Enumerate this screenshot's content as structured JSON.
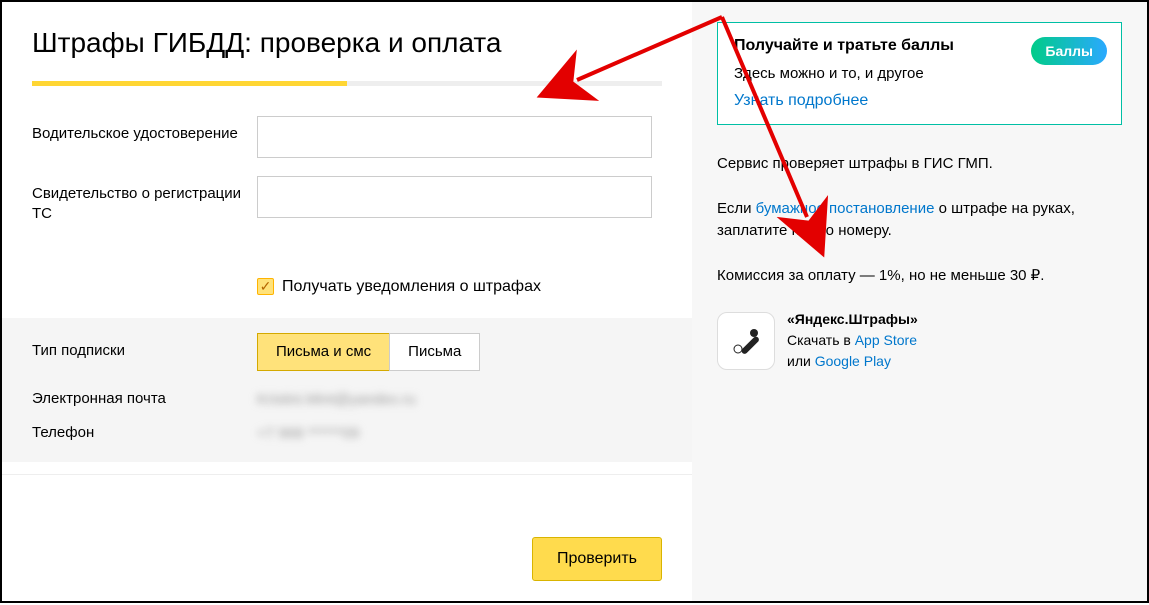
{
  "page": {
    "title": "Штрафы ГИБДД: проверка и оплата"
  },
  "form": {
    "license_label": "Водительское удостоверение",
    "registration_label": "Свидетельство о регистрации ТС",
    "notify_label": "Получать уведомления о штрафах",
    "subscription_type_label": "Тип подписки",
    "toggle_letters_sms": "Письма и смс",
    "toggle_letters": "Письма",
    "email_label": "Электронная почта",
    "email_value": "Kristini.Mint@yandex.ru",
    "phone_label": "Телефон",
    "phone_value": "+7 968 ******09",
    "submit_label": "Проверить"
  },
  "promo": {
    "title": "Получайте и тратьте баллы",
    "subtitle": "Здесь можно и то, и другое",
    "link": "Узнать подробнее",
    "badge": "Баллы"
  },
  "info": {
    "p1": "Сервис проверяет штрафы в ГИС ГМП.",
    "p2_pre": "Если ",
    "p2_link": "бумажное постановление",
    "p2_post": " о штрафе на руках, заплатите по его номеру.",
    "p3": "Комиссия за оплату — 1%, но не меньше 30 ₽."
  },
  "app": {
    "title": "«Яндекс.Штрафы»",
    "download_prefix": "Скачать в ",
    "appstore": "App Store",
    "or": "или ",
    "googleplay": "Google Play"
  }
}
